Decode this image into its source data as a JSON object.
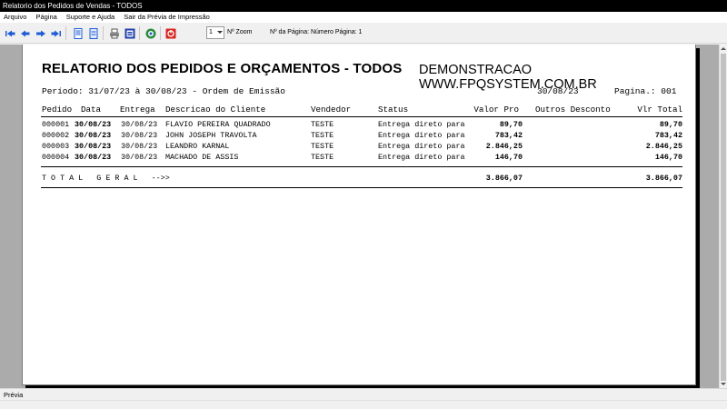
{
  "window": {
    "title": "Relatorio dos Pedidos de Vendas - TODOS"
  },
  "menu": [
    "Arquivo",
    "Página",
    "Suporte e Ajuda",
    "Sair da Prévia de Impressão"
  ],
  "toolbar": {
    "zoom_value": "1",
    "zoom_label": "Nº Zoom",
    "page_label": "Nº da Página: Número Página: 1"
  },
  "report": {
    "title": "RELATORIO DOS PEDIDOS E ORÇAMENTOS - TODOS",
    "company": "DEMONSTRACAO WWW.FPQSYSTEM.COM.BR",
    "period": "Período: 31/07/23 à 30/08/23 - Ordem de Emissão",
    "date": "30/08/23",
    "page_label": "Pagina.: 001",
    "columns": {
      "pedido": "Pedido",
      "data": "Data",
      "entrega": "Entrega",
      "cliente": "Descricao do Cliente",
      "vendedor": "Vendedor",
      "status": "Status",
      "valor": "Valor Pro",
      "outros": "Outros Desconto",
      "total": "Vlr Total"
    },
    "rows": [
      {
        "pedido": "000001",
        "data": "30/08/23",
        "entrega": "30/08/23",
        "cliente": "FLAVIO PEREIRA QUADRADO",
        "vendedor": "TESTE",
        "status": "Entrega direto para",
        "valor": "89,70",
        "total": "89,70"
      },
      {
        "pedido": "000002",
        "data": "30/08/23",
        "entrega": "30/08/23",
        "cliente": "JOHN JOSEPH TRAVOLTA",
        "vendedor": "TESTE",
        "status": "Entrega direto para",
        "valor": "783,42",
        "total": "783,42"
      },
      {
        "pedido": "000003",
        "data": "30/08/23",
        "entrega": "30/08/23",
        "cliente": "LEANDRO KARNAL",
        "vendedor": "TESTE",
        "status": "Entrega direto para",
        "valor": "2.846,25",
        "total": "2.846,25"
      },
      {
        "pedido": "000004",
        "data": "30/08/23",
        "entrega": "30/08/23",
        "cliente": "MACHADO DE ASSIS",
        "vendedor": "TESTE",
        "status": "Entrega direto para",
        "valor": "146,70",
        "total": "146,70"
      }
    ],
    "total": {
      "label": "T O T A L   G E R A L   -->>",
      "valor": "3.866,07",
      "total": "3.866,07"
    }
  },
  "status": {
    "text": "Prévia"
  }
}
